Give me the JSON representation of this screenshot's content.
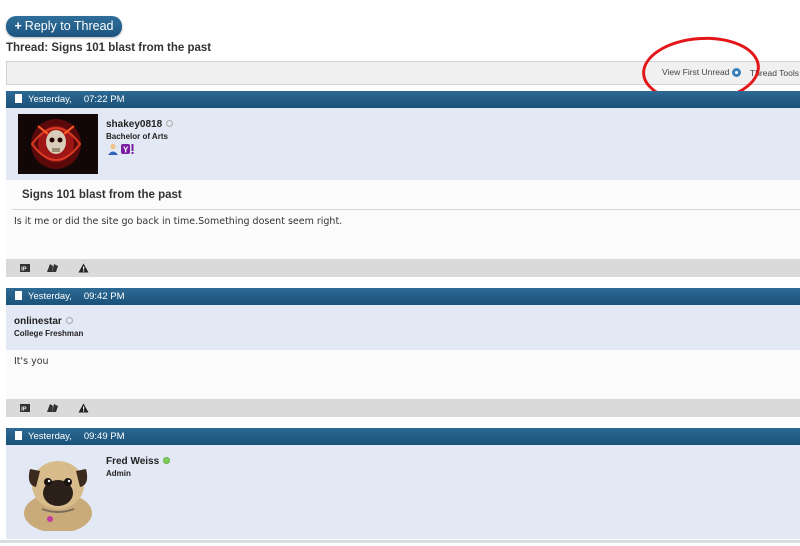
{
  "header": {
    "reply_button": "Reply to Thread",
    "thread_title": "Thread: Signs 101 blast from the past"
  },
  "toolbar": {
    "view_first_unread": "View First Unread",
    "thread_tools": "Thread Tools"
  },
  "annotation": {
    "color": "#e3171a"
  },
  "posts": [
    {
      "date": "Yesterday,",
      "time": "07:22 PM",
      "username": "shakey0818",
      "rank": "Bachelor of Arts",
      "online": false,
      "subject": "Signs 101 blast from the past",
      "message": "Is it me or did the site go back in time.Something dosent seem right."
    },
    {
      "date": "Yesterday,",
      "time": "09:42 PM",
      "username": "onlinestar",
      "rank": "College Freshman",
      "online": false,
      "subject": "",
      "message": "It's you"
    },
    {
      "date": "Yesterday,",
      "time": "09:49 PM",
      "username": "Fred Weiss",
      "rank": "Admin",
      "online": true,
      "subject": "",
      "message": ""
    }
  ],
  "colors": {
    "post_header": "#1f5a84",
    "user_area": "#e3e8f5",
    "footer": "#dadada"
  }
}
